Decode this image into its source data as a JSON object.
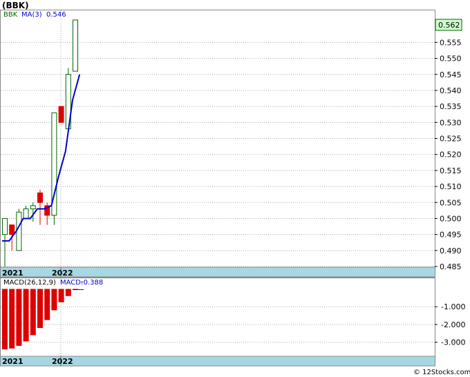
{
  "ticker": "(BBK)",
  "legend": {
    "symbol": "BBK",
    "ma_label": "MA(3)",
    "ma_value": "0.546",
    "macd_params": "MACD(26,12,9)",
    "macd_label": "MACD:",
    "macd_value": "-0.388"
  },
  "last_price_tag": "0.562",
  "watermark": "© 12Stocks.com",
  "colors": {
    "up_candle": "#006400",
    "down_candle": "#dd0000",
    "ma_line": "#0000cc",
    "macd_bar": "#dd0000",
    "axis_band": "#a6d7e2",
    "price_tag_bg": "#ccffcc"
  },
  "chart_data": [
    {
      "type": "candlestick",
      "title": "(BBK)",
      "ylim": [
        0.485,
        0.565
      ],
      "y_ticks": [
        "0.485",
        "0.490",
        "0.495",
        "0.500",
        "0.505",
        "0.510",
        "0.515",
        "0.520",
        "0.525",
        "0.530",
        "0.535",
        "0.540",
        "0.545",
        "0.550",
        "0.555"
      ],
      "x_labels": [
        "2021",
        "2022"
      ],
      "grid": true,
      "candles": [
        {
          "open": 0.495,
          "high": 0.5,
          "low": 0.485,
          "close": 0.5
        },
        {
          "open": 0.498,
          "high": 0.498,
          "low": 0.49,
          "close": 0.495
        },
        {
          "open": 0.49,
          "high": 0.503,
          "low": 0.49,
          "close": 0.502
        },
        {
          "open": 0.5,
          "high": 0.504,
          "low": 0.5,
          "close": 0.503
        },
        {
          "open": 0.503,
          "high": 0.505,
          "low": 0.499,
          "close": 0.504
        },
        {
          "open": 0.508,
          "high": 0.509,
          "low": 0.498,
          "close": 0.505
        },
        {
          "open": 0.504,
          "high": 0.505,
          "low": 0.498,
          "close": 0.501
        },
        {
          "open": 0.501,
          "high": 0.533,
          "low": 0.498,
          "close": 0.533
        },
        {
          "open": 0.535,
          "high": 0.535,
          "low": 0.53,
          "close": 0.53
        },
        {
          "open": 0.528,
          "high": 0.547,
          "low": 0.528,
          "close": 0.545
        },
        {
          "open": 0.546,
          "high": 0.562,
          "low": 0.546,
          "close": 0.562
        }
      ],
      "ma3": [
        0.493,
        0.493,
        0.496,
        0.5,
        0.5,
        0.503,
        0.503,
        0.504,
        0.513,
        0.521,
        0.537,
        0.545
      ]
    },
    {
      "type": "bar",
      "title": "MACD(26,12,9)",
      "ylim": [
        -3.75,
        0.6
      ],
      "y_ticks": [
        "-1.000",
        "-2.000",
        "-3.000"
      ],
      "y_tick_values": [
        -1,
        -2,
        -3
      ],
      "x_labels": [
        "2021",
        "2022"
      ],
      "values": [
        -3.4,
        -3.35,
        -3.2,
        -2.95,
        -2.6,
        -2.2,
        -1.75,
        -1.2,
        -0.75,
        -0.4,
        -0.05
      ]
    }
  ]
}
